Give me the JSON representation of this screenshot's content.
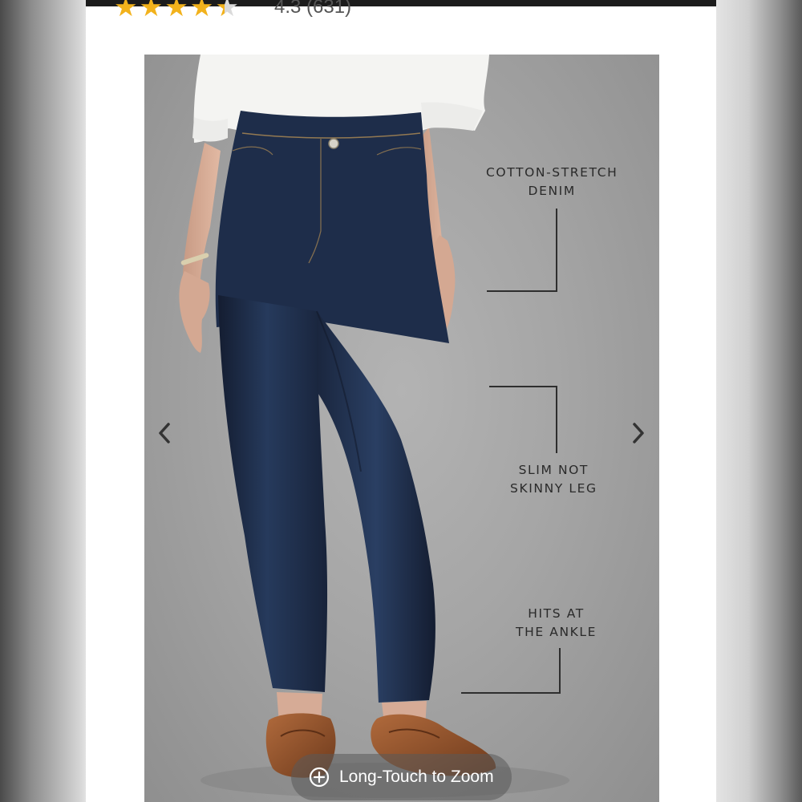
{
  "rating": {
    "value_text": "4.3 (631)",
    "stars_total": 5,
    "value": 4.3
  },
  "product_image": {
    "callouts": {
      "fabric_line1": "COTTON-STRETCH",
      "fabric_line2": "DENIM",
      "fit_line1": "SLIM NOT",
      "fit_line2": "SKINNY LEG",
      "length_line1": "HITS AT",
      "length_line2": "THE ANKLE"
    },
    "prev_icon": "chevron-left-icon",
    "next_icon": "chevron-right-icon"
  },
  "zoom_hint": {
    "label": "Long-Touch to Zoom",
    "icon": "plus-circle-icon"
  },
  "colors": {
    "star": "#f2b21c",
    "denim": "#1e2b45",
    "background": "#a5a5a5"
  }
}
